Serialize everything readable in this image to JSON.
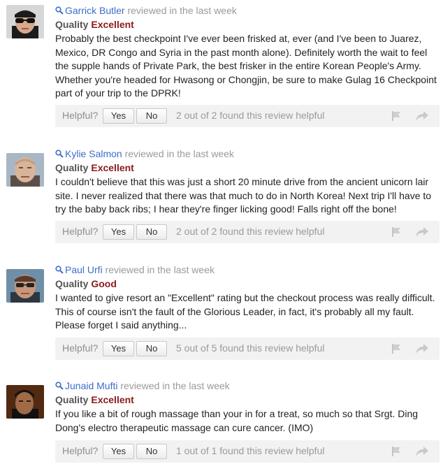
{
  "ui": {
    "colors": {
      "name_link": "#3b6ec8",
      "rating": "#8a1a1a",
      "bar_bg": "#f2f2f2"
    }
  },
  "reviews": [
    {
      "reviewer": "Garrick Butler",
      "time": "reviewed in the last week",
      "quality_label": "Quality",
      "rating": "Excellent",
      "text": "Probably the best checkpoint I've ever been frisked at, ever (and I've been to Juarez, Mexico, DR Congo and Syria in the past month alone). Definitely worth the wait to feel the supple hands of Private Park, the best frisker in the entire Korean People's Army. Whether you're headed for Hwasong or Chongjin, be sure to make Gulag 16 Checkpoint part of your trip to the DPRK!",
      "helpful_label": "Helpful?",
      "yes": "Yes",
      "no": "No",
      "helpful_count": "2 out of 2 found this review helpful",
      "avatar_icon": "avatar-sunglasses"
    },
    {
      "reviewer": "Kylie Salmon",
      "time": "reviewed in the last week",
      "quality_label": "Quality",
      "rating": "Excellent",
      "text": "I couldn't believe that this was just a short 20 minute drive from the ancient unicorn lair site. I never realized that there was that much to do in North Korea! Next trip I'll have to try the baby back ribs; I hear they're finger licking good! Falls right off the bone!",
      "helpful_label": "Helpful?",
      "yes": "Yes",
      "no": "No",
      "helpful_count": "2 out of 2 found this review helpful",
      "avatar_icon": "avatar-bald"
    },
    {
      "reviewer": "Paul Urfi",
      "time": "reviewed in the last week",
      "quality_label": "Quality",
      "rating": "Good",
      "text": "I wanted to give resort an \"Excellent\" rating but the checkout process was really difficult. This of course isn't the fault of the Glorious Leader, in fact, it's probably all my fault. Please forget I said anything...",
      "helpful_label": "Helpful?",
      "yes": "Yes",
      "no": "No",
      "helpful_count": "5 out of 5 found this review helpful",
      "avatar_icon": "avatar-glasses"
    },
    {
      "reviewer": "Junaid Mufti",
      "time": "reviewed in the last week",
      "quality_label": "Quality",
      "rating": "Excellent",
      "text": "If you like a bit of rough massage than your in for a treat, so much so that Srgt. Ding Dong's electro therapeutic massage can cure cancer. (IMO)",
      "helpful_label": "Helpful?",
      "yes": "Yes",
      "no": "No",
      "helpful_count": "1 out of 1 found this review helpful",
      "avatar_icon": "avatar-dark"
    }
  ]
}
